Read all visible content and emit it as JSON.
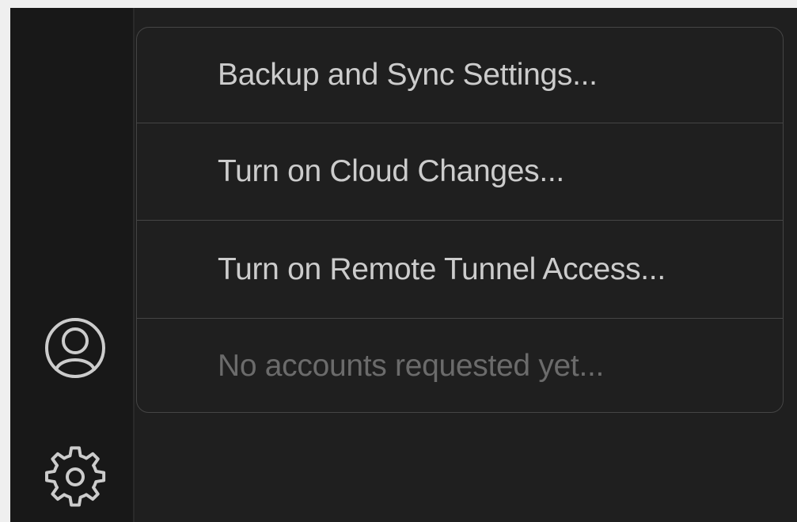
{
  "colors": {
    "activity_bar_bg": "#181818",
    "editor_bg": "#1f1f1f",
    "menu_border": "#454545",
    "menu_text": "#cccccc",
    "menu_text_disabled": "#6b6b6b",
    "icon_stroke": "#cccccc"
  },
  "activity_bar": {
    "account_icon": "account-icon",
    "settings_icon": "gear-icon"
  },
  "accounts_menu": {
    "items": [
      {
        "label": "Backup and Sync Settings...",
        "enabled": true
      },
      {
        "label": "Turn on Cloud Changes...",
        "enabled": true
      },
      {
        "label": "Turn on Remote Tunnel Access...",
        "enabled": true
      },
      {
        "label": "No accounts requested yet...",
        "enabled": false
      }
    ]
  }
}
